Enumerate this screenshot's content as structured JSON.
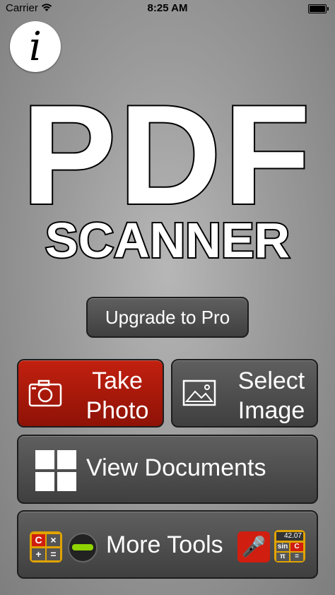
{
  "status_bar": {
    "carrier": "Carrier",
    "time": "8:25 AM"
  },
  "info_button": {
    "glyph": "i"
  },
  "title": {
    "main": "PDF",
    "sub": "SCANNER"
  },
  "buttons": {
    "upgrade": "Upgrade to Pro",
    "take_photo": [
      "Take",
      "Photo"
    ],
    "select_image": [
      "Select",
      "Image"
    ],
    "view_documents": "View Documents",
    "more_tools": "More Tools"
  },
  "tool_icons": {
    "calc_keys": [
      "C",
      "×",
      "+",
      "="
    ],
    "sci_calc_display": "42.07",
    "sci_calc_keys": [
      "sin",
      "C",
      "π",
      "="
    ]
  },
  "colors": {
    "take_photo_red": "#c2200f",
    "button_dark": "#4f4f4f",
    "calc_orange": "#e0a300"
  }
}
